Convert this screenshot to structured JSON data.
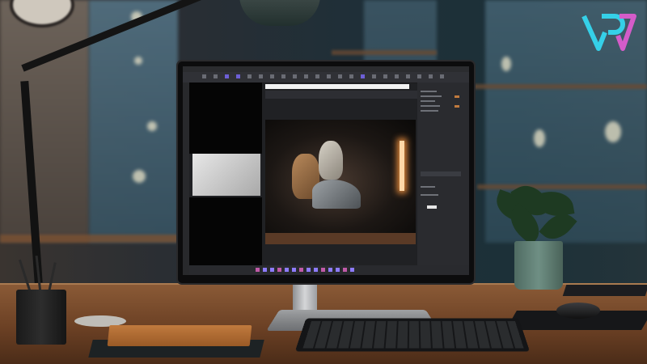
{
  "scene": {
    "description_tag": "",
    "screen_app": {
      "toolbar_icons": 22,
      "highlight_color": "#6d5fd6",
      "accent_color": "#c07a3e"
    },
    "logo": {
      "colors": [
        "#35d0e8",
        "#d45cc9"
      ],
      "icon": "logo-icon"
    }
  }
}
